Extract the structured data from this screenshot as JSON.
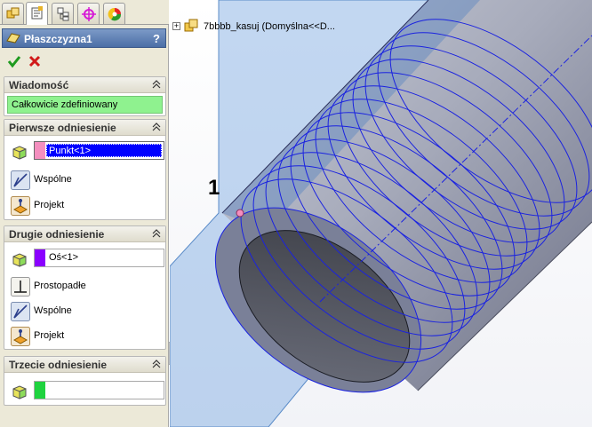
{
  "feature": {
    "title": "Płaszczyzna1",
    "help_label": "?"
  },
  "tabs": [
    {
      "icon": "feature-manager-icon"
    },
    {
      "icon": "property-manager-icon"
    },
    {
      "icon": "configuration-manager-icon"
    },
    {
      "icon": "dimxpert-manager-icon"
    },
    {
      "icon": "display-manager-icon"
    }
  ],
  "message": {
    "header": "Wiadomość",
    "status": "Całkowicie zdefiniowany"
  },
  "first_reference": {
    "header": "Pierwsze odniesienie",
    "selection": "Punkt<1>",
    "swatch_color": "#f48fbf",
    "options": [
      "Wspólne",
      "Projekt"
    ]
  },
  "second_reference": {
    "header": "Drugie odniesienie",
    "selection": "Oś<1>",
    "swatch_color": "#8a00ff",
    "options": [
      "Prostopadłe",
      "Wspólne",
      "Projekt"
    ]
  },
  "third_reference": {
    "header": "Trzecie odniesienie",
    "selection": "",
    "swatch_color": "#1fd33f"
  },
  "tree": {
    "part_label": "7bbbb_kasuj  (Domyślna<<D..."
  },
  "callout": {
    "label": "1"
  },
  "colors": {
    "accent": "#4b6ea6",
    "status_ok": "#8ff28f",
    "edge_blue": "#1a22e0",
    "plane_blue": "#8fb7e6"
  }
}
